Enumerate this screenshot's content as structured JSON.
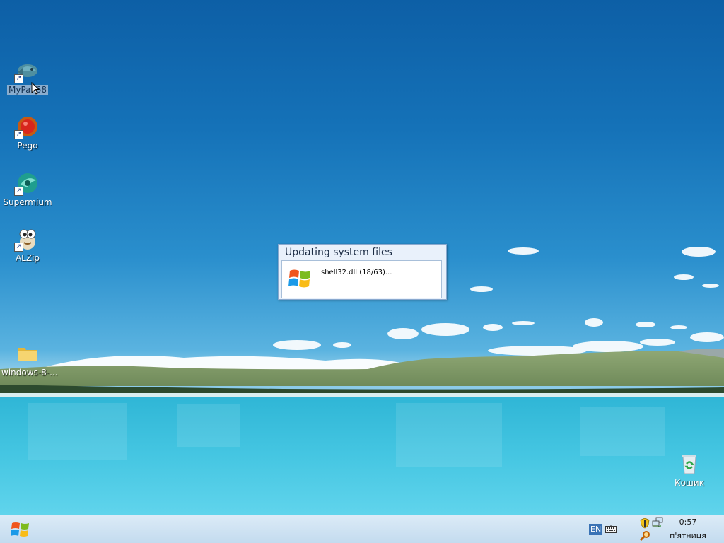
{
  "desktop": {
    "icons": [
      {
        "label": "MyPal 68",
        "icon": "mypal-browser-icon"
      },
      {
        "label": "Pego",
        "icon": "pego-icon"
      },
      {
        "label": "Supermium",
        "icon": "supermium-browser-icon"
      },
      {
        "label": "ALZip",
        "icon": "alzip-icon"
      },
      {
        "label": "windows-8-...",
        "icon": "folder-icon"
      },
      {
        "label": "Кошик",
        "icon": "recycle-bin-icon"
      }
    ]
  },
  "dialog": {
    "title": "Updating system files",
    "status": "shell32.dll (18/63)..."
  },
  "taskbar": {
    "language": "EN",
    "clock_time": "0:57",
    "clock_day": "п'ятниця"
  },
  "colors": {
    "sky_top": "#0d5fa6",
    "lake": "#3fc0dc",
    "taskbar": "#d4e6f5",
    "dialog_border": "#8aa9cf"
  }
}
